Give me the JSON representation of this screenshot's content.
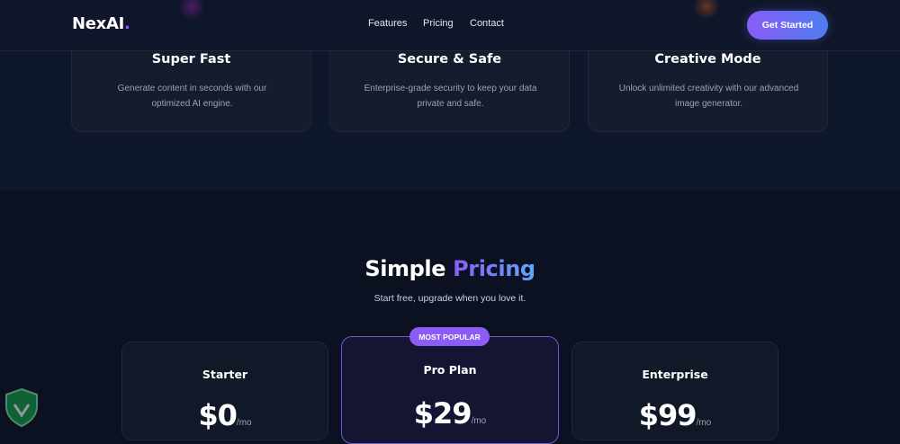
{
  "nav": {
    "logo_text": "NexAI",
    "logo_dot": ".",
    "links": [
      "Features",
      "Pricing",
      "Contact"
    ],
    "cta_label": "Get Started"
  },
  "features": [
    {
      "title": "Super Fast",
      "description": "Generate content in seconds with our optimized AI engine."
    },
    {
      "title": "Secure & Safe",
      "description": "Enterprise-grade security to keep your data private and safe."
    },
    {
      "title": "Creative Mode",
      "description": "Unlock unlimited creativity with our advanced image generator."
    }
  ],
  "pricing": {
    "title_plain": "Simple",
    "title_accent": "Pricing",
    "subtitle": "Start free, upgrade when you love it.",
    "badge": "MOST POPULAR",
    "plans": [
      {
        "name": "Starter",
        "price": "$0",
        "period": "/mo"
      },
      {
        "name": "Pro Plan",
        "price": "$29",
        "period": "/mo"
      },
      {
        "name": "Enterprise",
        "price": "$99",
        "period": "/mo"
      }
    ]
  },
  "colors": {
    "accent": "#8b5cf6",
    "accent_blue": "#4f7df0",
    "background": "#0b1120"
  },
  "icons": {
    "watermark": "shield-icon"
  }
}
